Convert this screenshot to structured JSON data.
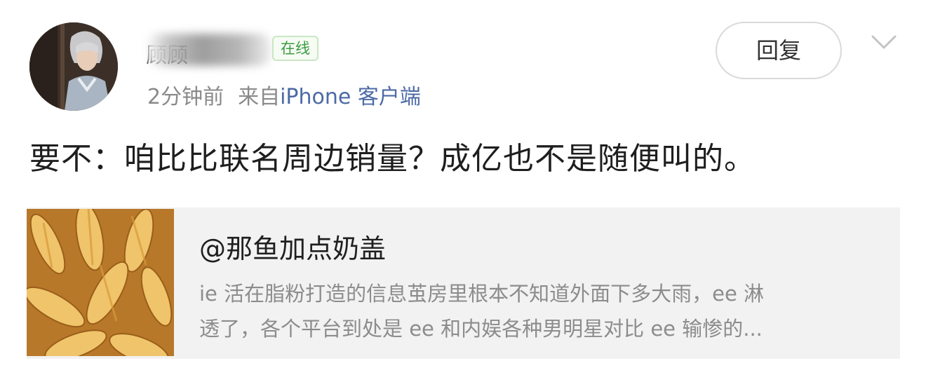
{
  "comment": {
    "username": "顾顾",
    "online_badge": "在线",
    "time": "2分钟前",
    "source_prefix": "来自",
    "source_device": "iPhone 客户端",
    "reply_label": "回复",
    "text": "要不：咱比比联名周边销量？成亿也不是随便叫的。"
  },
  "quote": {
    "title": "@那鱼加点奶盖",
    "body_lines": [
      "ie 活在脂粉打造的信息茧房里根本不知道外面下多大雨，ee 淋",
      "透了，各个平台到处是 ee 和内娱各种男明星对比 ee 输惨的..."
    ]
  },
  "colors": {
    "online_green": "#3c9b40",
    "device_link": "#4c6aa5",
    "card_bg": "#f2f2f2"
  },
  "icons": {
    "avatar": "avatar-photo",
    "more": "chevron-down-icon",
    "thumbnail": "sunflower-seeds-image"
  }
}
